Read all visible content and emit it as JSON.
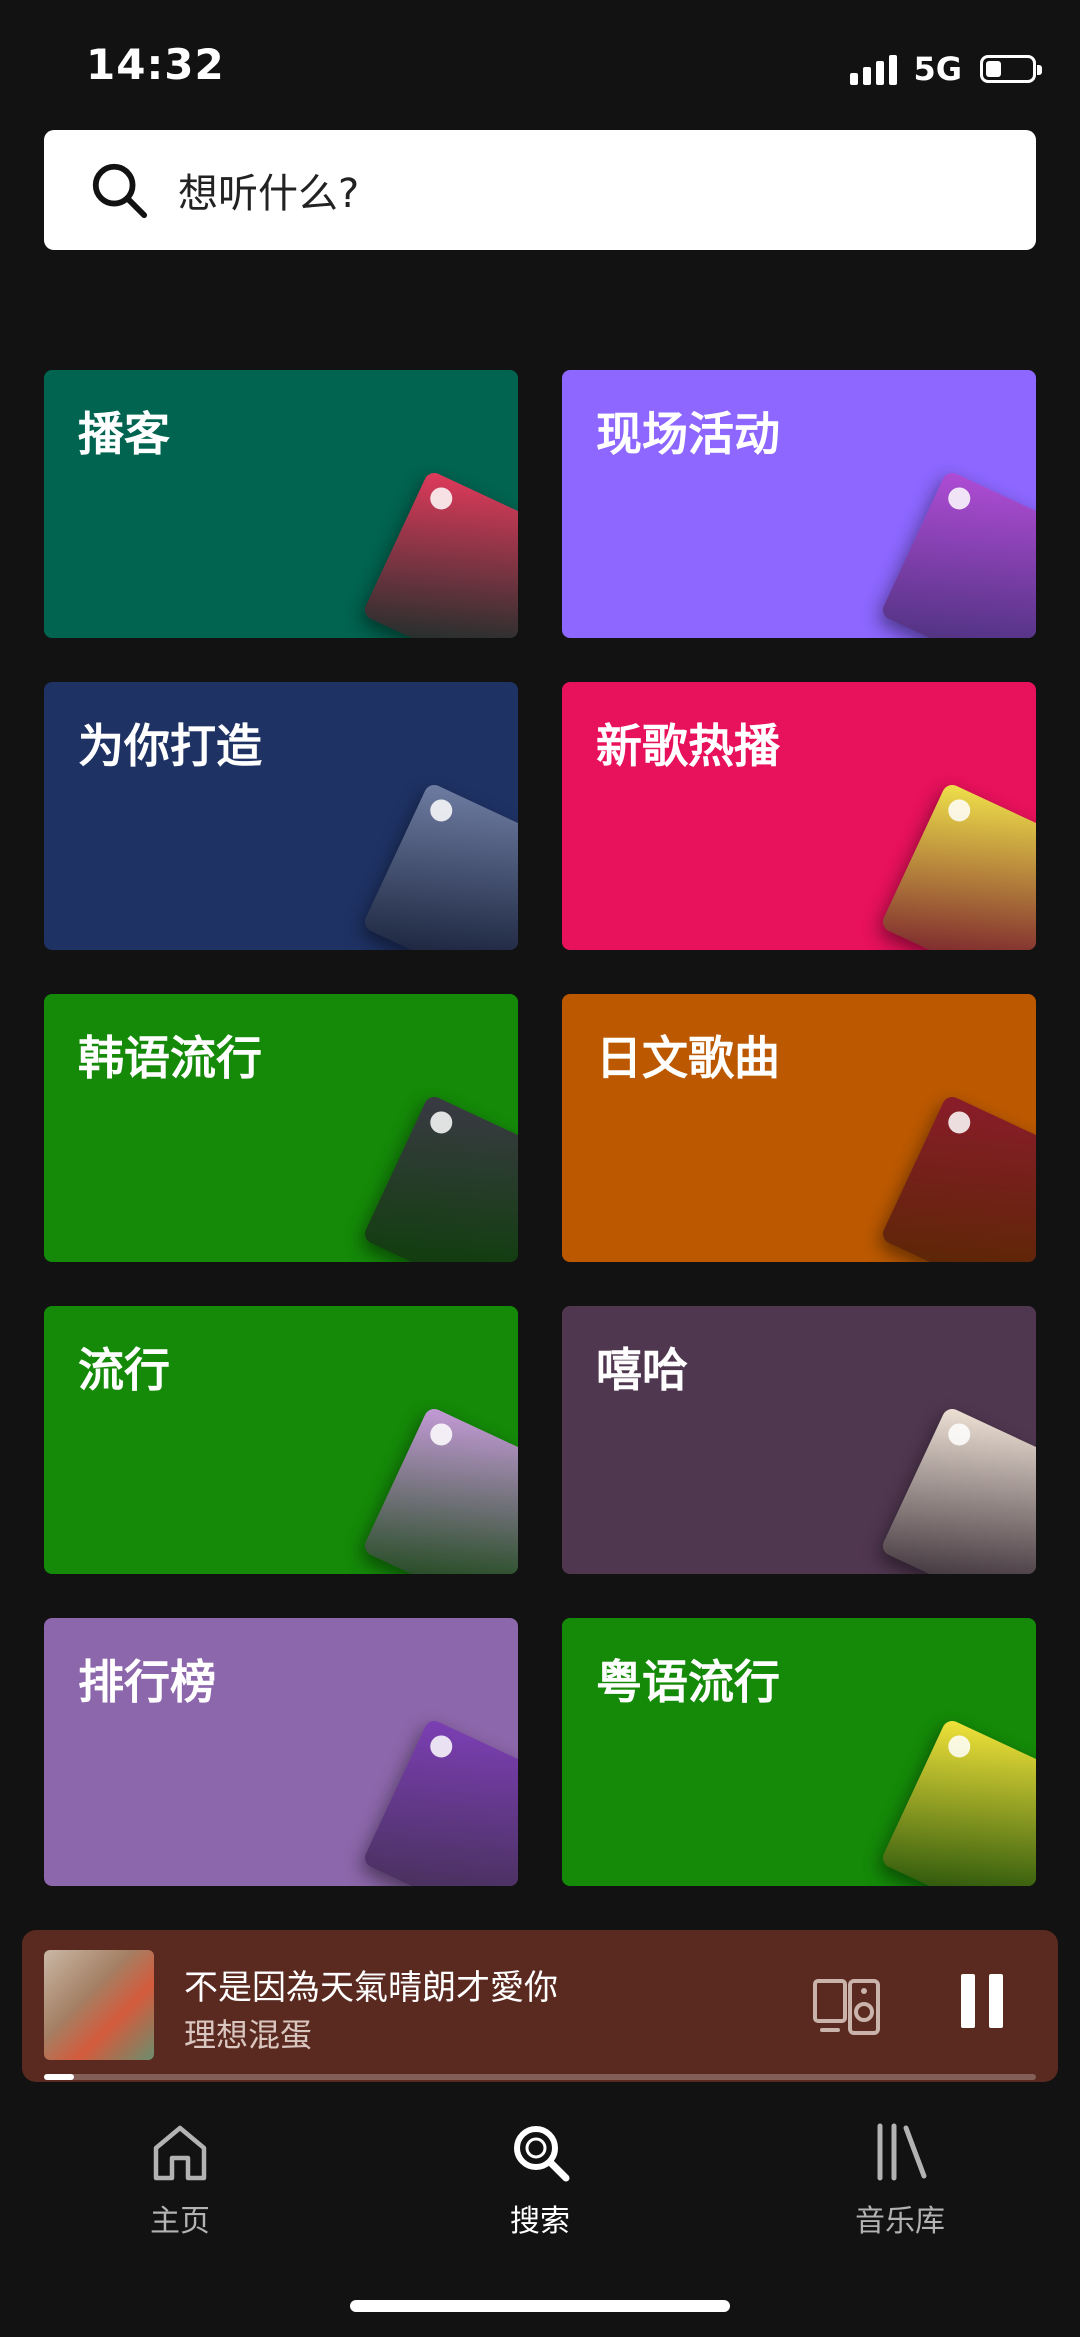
{
  "status_bar": {
    "time": "14:32",
    "network": "5G",
    "battery_level": 0.35
  },
  "search": {
    "placeholder": "想听什么?"
  },
  "categories": [
    {
      "label": "播客",
      "color": "#006450",
      "art_color": "#e13a5b",
      "art_icon": "podcast-cover"
    },
    {
      "label": "现场活动",
      "color": "#8d67ff",
      "art_color": "#b04cd6",
      "art_icon": "concert-cover"
    },
    {
      "label": "为你打造",
      "color": "#1e3264",
      "art_color": "#6f7da3",
      "art_icon": "pop-mix-cover"
    },
    {
      "label": "新歌热播",
      "color": "#e8115b",
      "art_color": "#f0e24a",
      "art_icon": "new-music-cover"
    },
    {
      "label": "韩语流行",
      "color": "#148a08",
      "art_color": "#3a3a44",
      "art_icon": "kpop-cover"
    },
    {
      "label": "日文歌曲",
      "color": "#bc5900",
      "art_color": "#8a1c2a",
      "art_icon": "tokyo-cover"
    },
    {
      "label": "流行",
      "color": "#148a08",
      "art_color": "#c59bd8",
      "art_icon": "pop-cover"
    },
    {
      "label": "嘻哈",
      "color": "#503750",
      "art_color": "#efe2d6",
      "art_icon": "hiphop-cover"
    },
    {
      "label": "排行榜",
      "color": "#8d67ab",
      "art_color": "#7c3fb5",
      "art_icon": "charts-cover"
    },
    {
      "label": "粤语流行",
      "color": "#148a08",
      "art_color": "#f3e43a",
      "art_icon": "cantopop-cover"
    }
  ],
  "mini_player": {
    "title": "不是因為天氣晴朗才愛你",
    "artist": "理想混蛋",
    "progress": 0.03,
    "background": "#5a2a21"
  },
  "bottom_nav": {
    "items": [
      {
        "label": "主页",
        "icon": "home-icon",
        "active": false
      },
      {
        "label": "搜索",
        "icon": "search-icon",
        "active": true
      },
      {
        "label": "音乐库",
        "icon": "library-icon",
        "active": false
      }
    ]
  }
}
